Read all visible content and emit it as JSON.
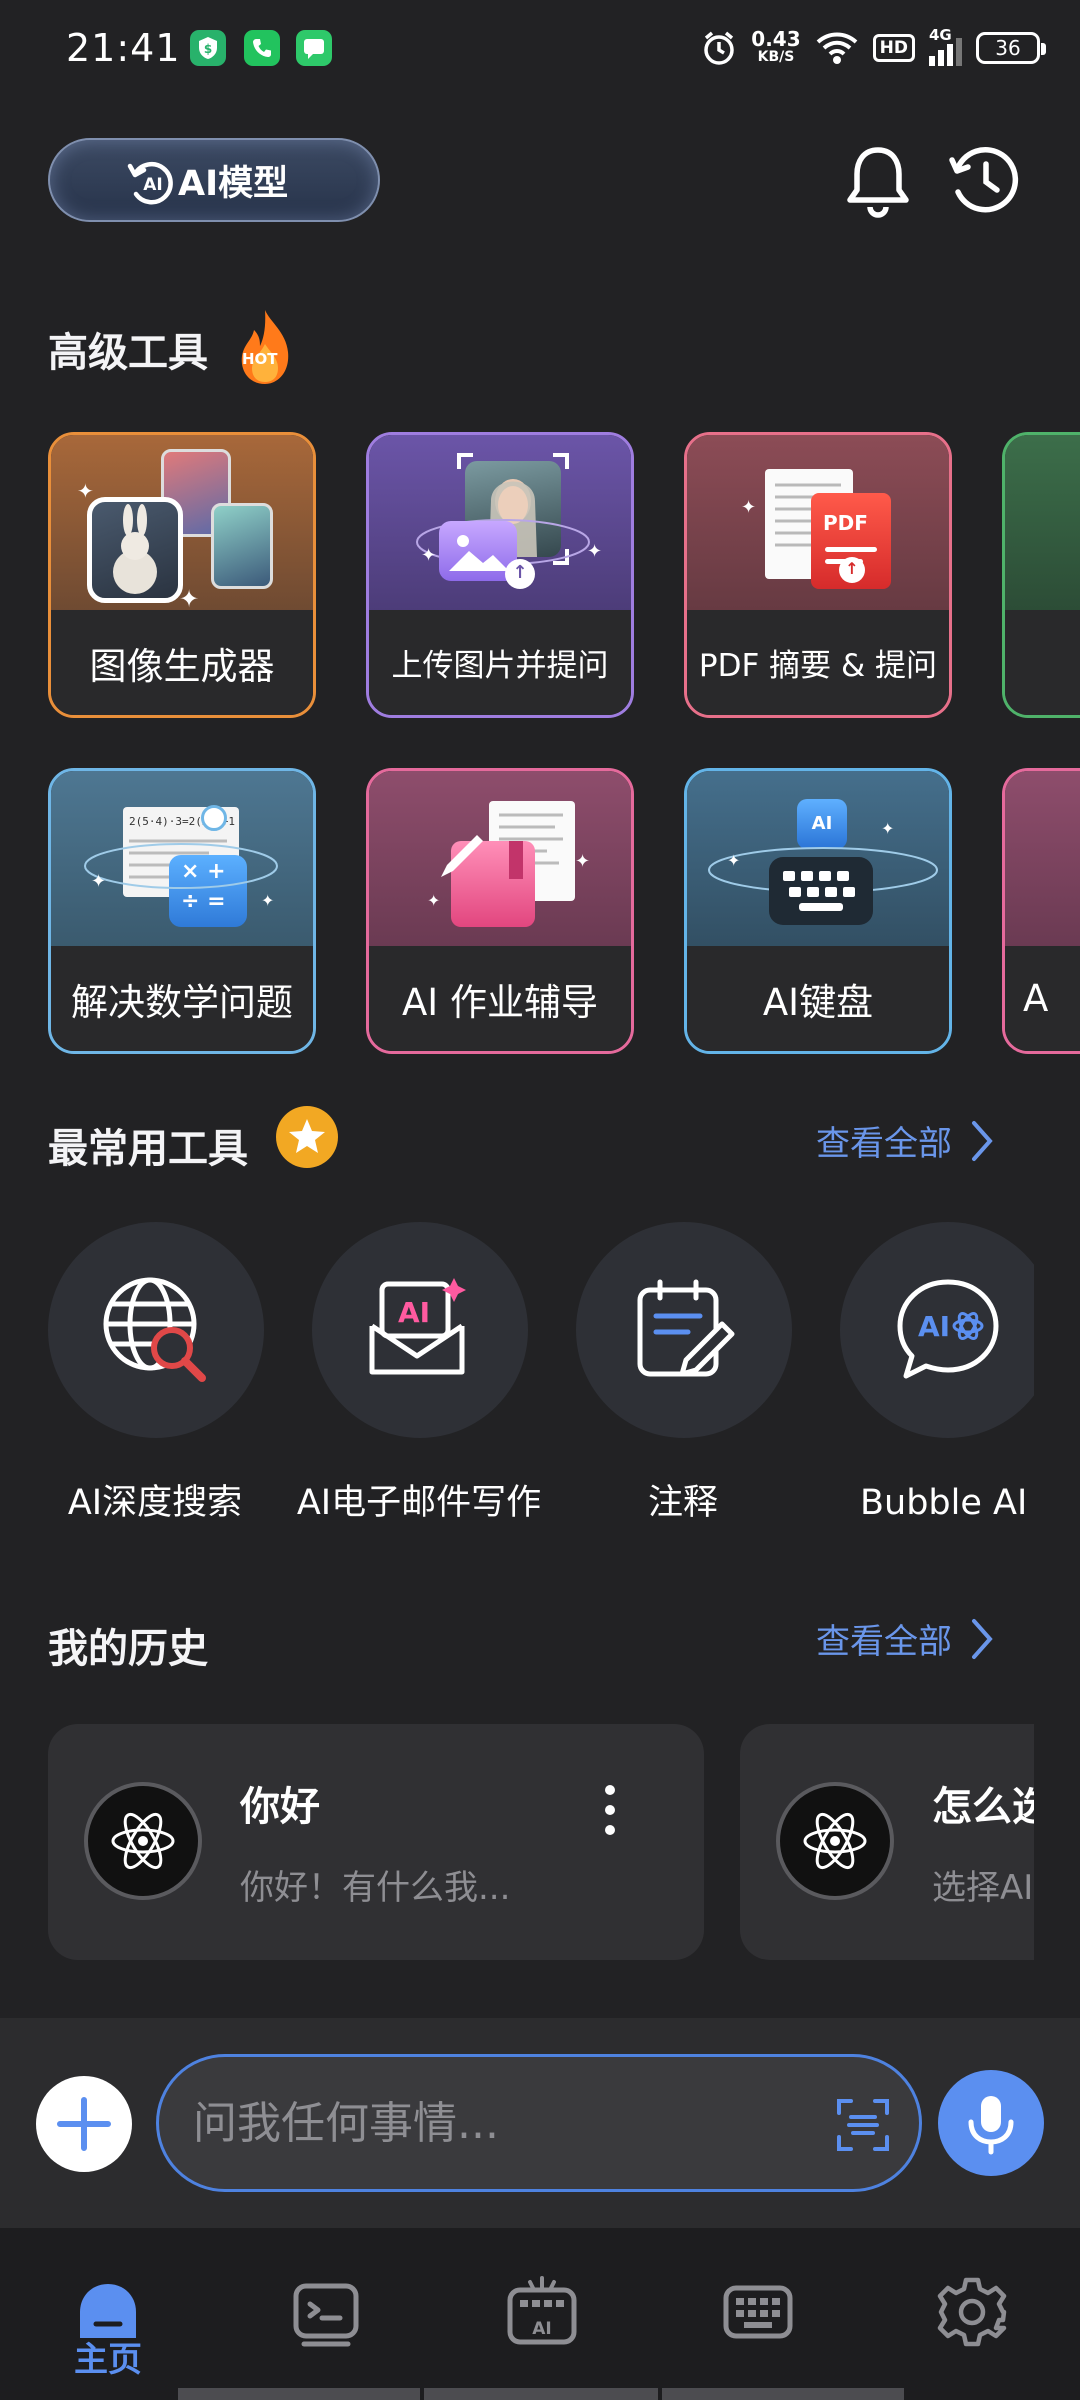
{
  "status_bar": {
    "time": "21:41",
    "net_speed": "0.43",
    "net_unit": "KB/S",
    "hd": "HD",
    "signal": "4G",
    "battery": "36"
  },
  "header": {
    "model_button": "AI模型",
    "bell_icon": "bell-icon",
    "history_icon": "history-clock-icon"
  },
  "advanced_tools": {
    "title": "高级工具",
    "hot_badge": "HOT",
    "row1": [
      "图像生成器",
      "上传图片并提问",
      "PDF 摘要 & 提问"
    ],
    "row2": [
      "解决数学问题",
      "AI 作业辅导",
      "AI键盘"
    ],
    "row2_peek": "A",
    "pdf_icon_text": "PDF"
  },
  "common_tools": {
    "title": "最常用工具",
    "see_all": "查看全部",
    "items": [
      "AI深度搜索",
      "AI电子邮件写作",
      "注释",
      "Bubble AI"
    ]
  },
  "history": {
    "title": "我的历史",
    "see_all": "查看全部",
    "items": [
      {
        "title": "你好",
        "preview": "你好！有什么我..."
      },
      {
        "title": "怎么选",
        "preview": "选择AI"
      }
    ]
  },
  "input": {
    "placeholder": "问我任何事情..."
  },
  "bottom_nav": {
    "home_label": "主页"
  },
  "colors": {
    "accent": "#5b8ff0",
    "background": "#222224",
    "image_card": "#e98f3a",
    "upload_card": "#9f7de0",
    "pdf_card": "#e7708a",
    "math_card": "#6fb6e6",
    "homework_card": "#e56a9c",
    "keyboard_card": "#63b4e8"
  }
}
